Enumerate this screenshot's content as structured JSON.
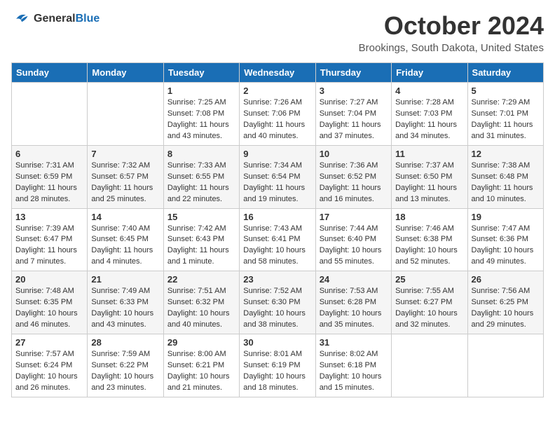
{
  "header": {
    "logo_general": "General",
    "logo_blue": "Blue",
    "month": "October 2024",
    "location": "Brookings, South Dakota, United States"
  },
  "days_of_week": [
    "Sunday",
    "Monday",
    "Tuesday",
    "Wednesday",
    "Thursday",
    "Friday",
    "Saturday"
  ],
  "weeks": [
    [
      {
        "day": "",
        "content": ""
      },
      {
        "day": "",
        "content": ""
      },
      {
        "day": "1",
        "content": "Sunrise: 7:25 AM\nSunset: 7:08 PM\nDaylight: 11 hours and 43 minutes."
      },
      {
        "day": "2",
        "content": "Sunrise: 7:26 AM\nSunset: 7:06 PM\nDaylight: 11 hours and 40 minutes."
      },
      {
        "day": "3",
        "content": "Sunrise: 7:27 AM\nSunset: 7:04 PM\nDaylight: 11 hours and 37 minutes."
      },
      {
        "day": "4",
        "content": "Sunrise: 7:28 AM\nSunset: 7:03 PM\nDaylight: 11 hours and 34 minutes."
      },
      {
        "day": "5",
        "content": "Sunrise: 7:29 AM\nSunset: 7:01 PM\nDaylight: 11 hours and 31 minutes."
      }
    ],
    [
      {
        "day": "6",
        "content": "Sunrise: 7:31 AM\nSunset: 6:59 PM\nDaylight: 11 hours and 28 minutes."
      },
      {
        "day": "7",
        "content": "Sunrise: 7:32 AM\nSunset: 6:57 PM\nDaylight: 11 hours and 25 minutes."
      },
      {
        "day": "8",
        "content": "Sunrise: 7:33 AM\nSunset: 6:55 PM\nDaylight: 11 hours and 22 minutes."
      },
      {
        "day": "9",
        "content": "Sunrise: 7:34 AM\nSunset: 6:54 PM\nDaylight: 11 hours and 19 minutes."
      },
      {
        "day": "10",
        "content": "Sunrise: 7:36 AM\nSunset: 6:52 PM\nDaylight: 11 hours and 16 minutes."
      },
      {
        "day": "11",
        "content": "Sunrise: 7:37 AM\nSunset: 6:50 PM\nDaylight: 11 hours and 13 minutes."
      },
      {
        "day": "12",
        "content": "Sunrise: 7:38 AM\nSunset: 6:48 PM\nDaylight: 11 hours and 10 minutes."
      }
    ],
    [
      {
        "day": "13",
        "content": "Sunrise: 7:39 AM\nSunset: 6:47 PM\nDaylight: 11 hours and 7 minutes."
      },
      {
        "day": "14",
        "content": "Sunrise: 7:40 AM\nSunset: 6:45 PM\nDaylight: 11 hours and 4 minutes."
      },
      {
        "day": "15",
        "content": "Sunrise: 7:42 AM\nSunset: 6:43 PM\nDaylight: 11 hours and 1 minute."
      },
      {
        "day": "16",
        "content": "Sunrise: 7:43 AM\nSunset: 6:41 PM\nDaylight: 10 hours and 58 minutes."
      },
      {
        "day": "17",
        "content": "Sunrise: 7:44 AM\nSunset: 6:40 PM\nDaylight: 10 hours and 55 minutes."
      },
      {
        "day": "18",
        "content": "Sunrise: 7:46 AM\nSunset: 6:38 PM\nDaylight: 10 hours and 52 minutes."
      },
      {
        "day": "19",
        "content": "Sunrise: 7:47 AM\nSunset: 6:36 PM\nDaylight: 10 hours and 49 minutes."
      }
    ],
    [
      {
        "day": "20",
        "content": "Sunrise: 7:48 AM\nSunset: 6:35 PM\nDaylight: 10 hours and 46 minutes."
      },
      {
        "day": "21",
        "content": "Sunrise: 7:49 AM\nSunset: 6:33 PM\nDaylight: 10 hours and 43 minutes."
      },
      {
        "day": "22",
        "content": "Sunrise: 7:51 AM\nSunset: 6:32 PM\nDaylight: 10 hours and 40 minutes."
      },
      {
        "day": "23",
        "content": "Sunrise: 7:52 AM\nSunset: 6:30 PM\nDaylight: 10 hours and 38 minutes."
      },
      {
        "day": "24",
        "content": "Sunrise: 7:53 AM\nSunset: 6:28 PM\nDaylight: 10 hours and 35 minutes."
      },
      {
        "day": "25",
        "content": "Sunrise: 7:55 AM\nSunset: 6:27 PM\nDaylight: 10 hours and 32 minutes."
      },
      {
        "day": "26",
        "content": "Sunrise: 7:56 AM\nSunset: 6:25 PM\nDaylight: 10 hours and 29 minutes."
      }
    ],
    [
      {
        "day": "27",
        "content": "Sunrise: 7:57 AM\nSunset: 6:24 PM\nDaylight: 10 hours and 26 minutes."
      },
      {
        "day": "28",
        "content": "Sunrise: 7:59 AM\nSunset: 6:22 PM\nDaylight: 10 hours and 23 minutes."
      },
      {
        "day": "29",
        "content": "Sunrise: 8:00 AM\nSunset: 6:21 PM\nDaylight: 10 hours and 21 minutes."
      },
      {
        "day": "30",
        "content": "Sunrise: 8:01 AM\nSunset: 6:19 PM\nDaylight: 10 hours and 18 minutes."
      },
      {
        "day": "31",
        "content": "Sunrise: 8:02 AM\nSunset: 6:18 PM\nDaylight: 10 hours and 15 minutes."
      },
      {
        "day": "",
        "content": ""
      },
      {
        "day": "",
        "content": ""
      }
    ]
  ]
}
